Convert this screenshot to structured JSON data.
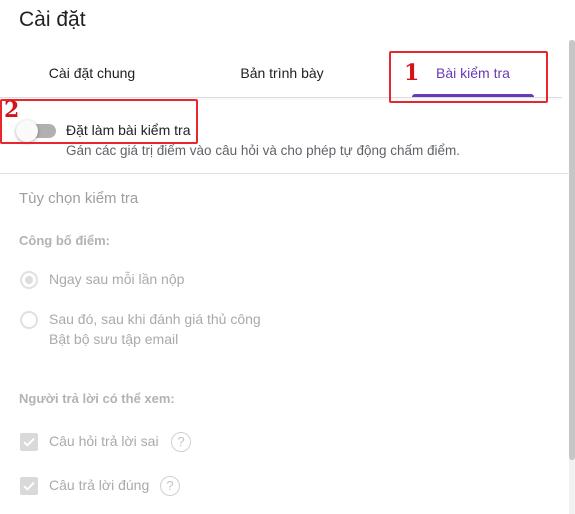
{
  "header": {
    "title": "Cài đặt"
  },
  "tabs": [
    {
      "label": "Cài đặt chung",
      "active": false
    },
    {
      "label": "Bản trình bày",
      "active": false
    },
    {
      "label": "Bài kiểm tra",
      "active": true
    }
  ],
  "quiz_toggle": {
    "label": "Đặt làm bài kiểm tra",
    "description": "Gán các giá trị điểm vào câu hỏi và cho phép tự động chấm điểm.",
    "enabled": false
  },
  "quiz_options": {
    "title": "Tùy chọn kiểm tra",
    "release_grade": {
      "label": "Công bố điểm:",
      "options": [
        {
          "label": "Ngay sau mỗi lần nộp",
          "selected": true
        },
        {
          "label": "Sau đó, sau khi đánh giá thủ công",
          "sublabel": "Bật bộ sưu tập email",
          "selected": false
        }
      ]
    },
    "respondent_can_see": {
      "label": "Người trả lời có thể xem:",
      "options": [
        {
          "label": "Câu hỏi trả lời sai",
          "checked": true
        },
        {
          "label": "Câu trả lời đúng",
          "checked": true
        }
      ]
    }
  },
  "annotations": {
    "marker_1": "1",
    "marker_2": "2",
    "color": "#e8262d"
  },
  "colors": {
    "accent": "#673ab7",
    "disabled_text": "#aaaaaa"
  },
  "icons": {
    "help": "?"
  }
}
